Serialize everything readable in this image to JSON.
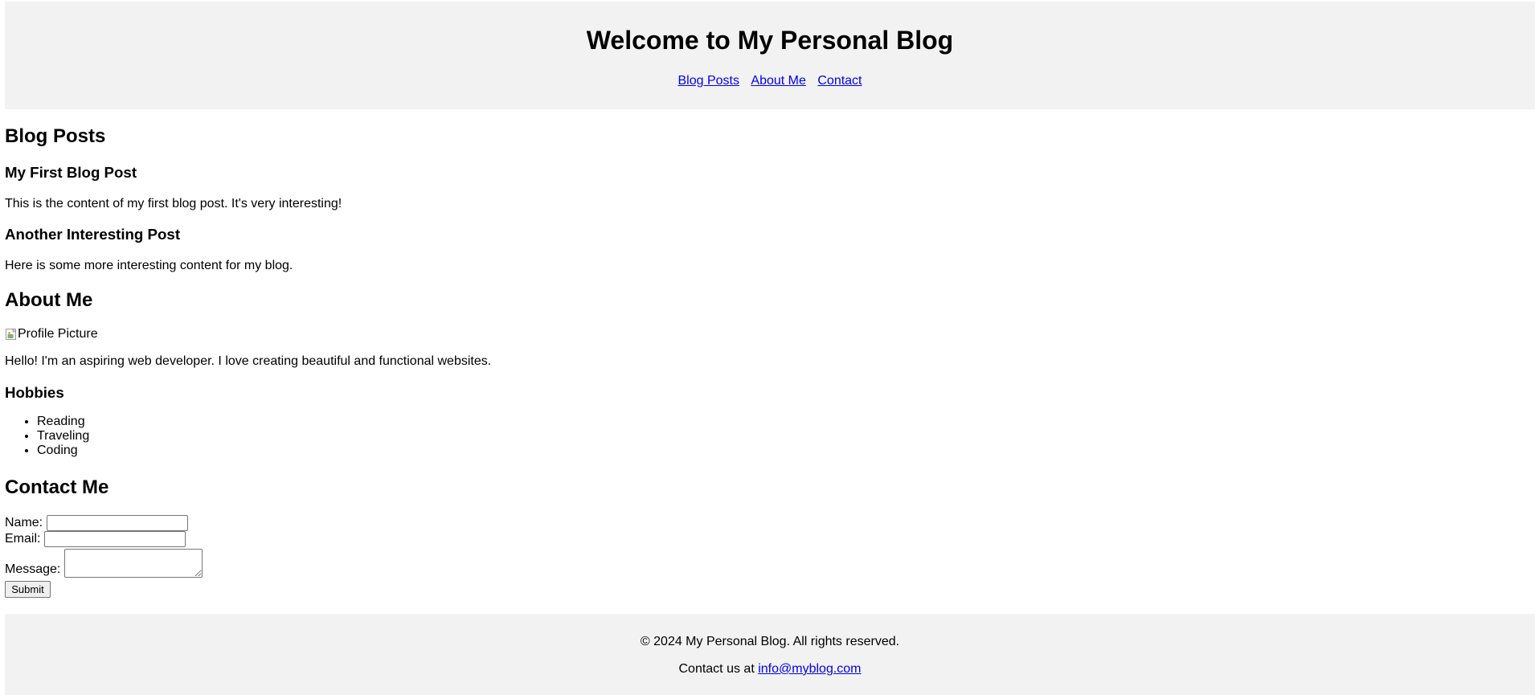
{
  "header": {
    "title": "Welcome to My Personal Blog",
    "nav": [
      {
        "label": "Blog Posts"
      },
      {
        "label": "About Me"
      },
      {
        "label": "Contact"
      }
    ]
  },
  "blog": {
    "heading": "Blog Posts",
    "posts": [
      {
        "title": "My First Blog Post",
        "content": "This is the content of my first blog post. It's very interesting!"
      },
      {
        "title": "Another Interesting Post",
        "content": "Here is some more interesting content for my blog."
      }
    ]
  },
  "about": {
    "heading": "About Me",
    "image_alt": "Profile Picture",
    "bio": "Hello! I'm an aspiring web developer. I love creating beautiful and functional websites.",
    "hobbies_heading": "Hobbies",
    "hobbies": [
      "Reading",
      "Traveling",
      "Coding"
    ]
  },
  "contact": {
    "heading": "Contact Me",
    "name_label": "Name:",
    "name_value": "",
    "email_label": "Email:",
    "email_value": "",
    "message_label": "Message:",
    "message_value": "",
    "submit_label": "Submit"
  },
  "footer": {
    "copyright": "© 2024 My Personal Blog. All rights reserved.",
    "contact_prefix": "Contact us at",
    "contact_email": "info@myblog.com"
  },
  "colors": {
    "band_background": "#f2f2f2",
    "link": "#0000ee"
  }
}
